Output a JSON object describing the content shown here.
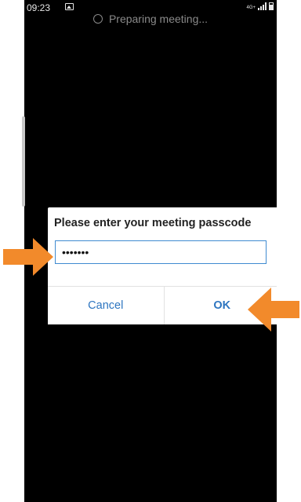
{
  "status_bar": {
    "time": "09:23",
    "network_label": "4G+",
    "icons": [
      "image-icon",
      "signal-icon",
      "battery-icon"
    ]
  },
  "preparing_text": "Preparing meeting...",
  "dialog": {
    "title": "Please enter your meeting passcode",
    "passcode_value": "•••••••",
    "cancel_label": "Cancel",
    "ok_label": "OK"
  },
  "colors": {
    "accent": "#2d75c0",
    "input_border": "#3f8bd1",
    "arrow": "#f28a2b",
    "background": "#000000"
  }
}
